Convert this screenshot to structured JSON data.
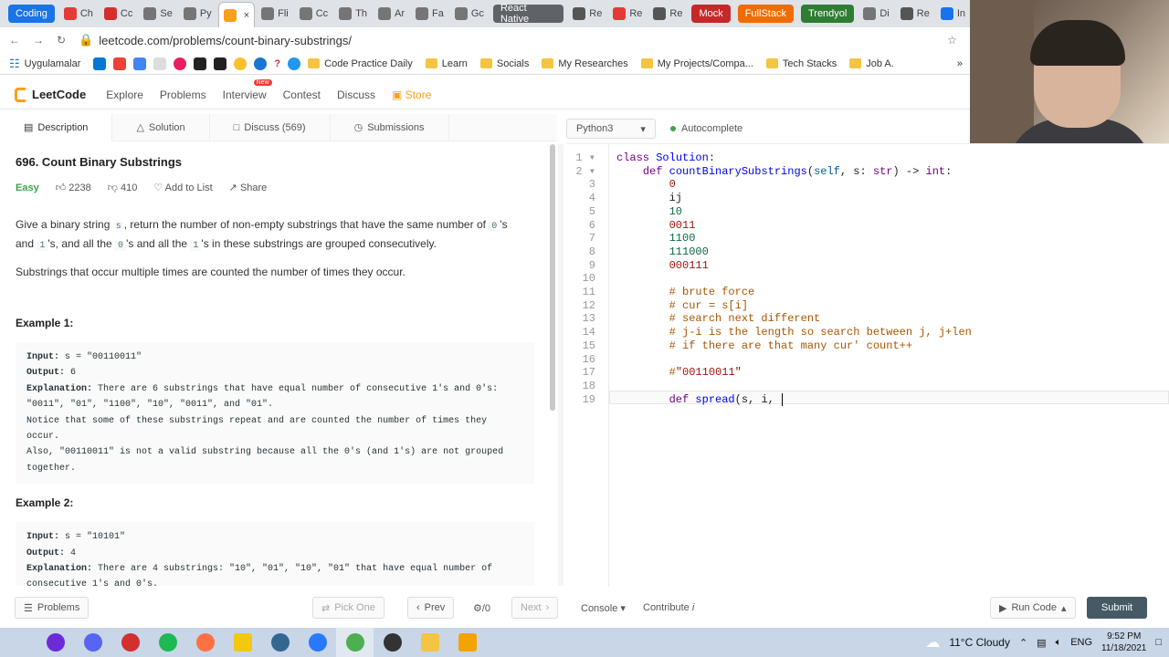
{
  "browser": {
    "tabs": [
      {
        "label": "Coding",
        "type": "group",
        "color": "#1a73e8"
      },
      {
        "label": "Ch",
        "color": "#e53935"
      },
      {
        "label": "Cc",
        "color": "#d32f2f"
      },
      {
        "label": "Se",
        "color": "#757575"
      },
      {
        "label": "Py",
        "color": "#757575"
      },
      {
        "label": "",
        "color": "#f89f1b",
        "active": true
      },
      {
        "label": "Fli",
        "color": "#757575"
      },
      {
        "label": "Cc",
        "color": "#757575"
      },
      {
        "label": "Th",
        "color": "#757575"
      },
      {
        "label": "Ar",
        "color": "#757575"
      },
      {
        "label": "Fa",
        "color": "#757575"
      },
      {
        "label": "Gc",
        "color": "#757575"
      },
      {
        "label": "React Native",
        "type": "group",
        "color": "#5f6368"
      },
      {
        "label": "Re",
        "color": "#555"
      },
      {
        "label": "Re",
        "color": "#e53935"
      },
      {
        "label": "Re",
        "color": "#555"
      },
      {
        "label": "Mock",
        "type": "group",
        "color": "#c62828"
      },
      {
        "label": "FullStack",
        "type": "group",
        "color": "#ef6c00"
      },
      {
        "label": "Trendyol",
        "type": "group",
        "color": "#2e7d32"
      },
      {
        "label": "Di",
        "color": "#757575"
      },
      {
        "label": "Re",
        "color": "#555"
      },
      {
        "label": "In",
        "color": "#1a73e8"
      }
    ],
    "url": "leetcode.com/problems/count-binary-substrings/",
    "bookmarks": [
      "Uygulamalar",
      "Code Practice Daily",
      "Learn",
      "Socials",
      "My Researches",
      "My Projects/Compa...",
      "Tech Stacks",
      "Job A."
    ],
    "bookmarks_more": "»"
  },
  "nav": {
    "brand": "LeetCode",
    "items": [
      "Explore",
      "Problems",
      "Interview",
      "Contest",
      "Discuss"
    ],
    "new_badge": "New",
    "store": "Store"
  },
  "subtabs": [
    "Description",
    "Solution",
    "Discuss (569)",
    "Submissions"
  ],
  "problem": {
    "title": "696. Count Binary Substrings",
    "difficulty": "Easy",
    "likes": "2238",
    "dislikes": "410",
    "add_to_list": "Add to List",
    "share": "Share",
    "desc_1a": "Give a binary string ",
    "desc_1_s": "s",
    "desc_1b": ", return the number of non-empty substrings that have the same number of ",
    "desc_zero": "0",
    "desc_1c": "'s and ",
    "desc_one": "1",
    "desc_1d": "'s, and all the ",
    "desc_1e": "'s and all the ",
    "desc_1f": "'s in these substrings are grouped consecutively.",
    "desc_2": "Substrings that occur multiple times are counted the number of times they occur.",
    "example1_title": "Example 1:",
    "ex1_input_label": "Input:",
    "ex1_input": " s = \"00110011\"",
    "ex1_output_label": "Output:",
    "ex1_output": " 6",
    "ex1_expl_label": "Explanation:",
    "ex1_expl": " There are 6 substrings that have equal number of consecutive 1's and 0's: \"0011\", \"01\", \"1100\", \"10\", \"0011\", and \"01\".\nNotice that some of these substrings repeat and are counted the number of times they occur.\nAlso, \"00110011\" is not a valid substring because all the 0's (and 1's) are not grouped together.",
    "example2_title": "Example 2:",
    "ex2_input_label": "Input:",
    "ex2_input": " s = \"10101\"",
    "ex2_output_label": "Output:",
    "ex2_output": " 4",
    "ex2_expl_label": "Explanation:",
    "ex2_expl": " There are 4 substrings: \"10\", \"01\", \"10\", \"01\" that have equal number of consecutive 1's and 0's."
  },
  "editor": {
    "language": "Python3",
    "autocomplete": "Autocomplete",
    "lines": [
      "class Solution:",
      "    def countBinarySubstrings(self, s: str) -> int:",
      "        0",
      "        ij",
      "        10",
      "        0011",
      "        1100",
      "        111000",
      "        000111",
      "",
      "        # brute force",
      "        # cur = s[i]",
      "        # search next different",
      "        # j-i is the length so search between j, j+len",
      "        # if there are that many cur' count++",
      "",
      "        #\"00110011\"",
      "",
      "        def spread(s, i, "
    ]
  },
  "bottom": {
    "problems": "Problems",
    "pick_one": "Pick One",
    "prev": "Prev",
    "page": "/0",
    "next": "Next",
    "console": "Console",
    "contribute": "Contribute",
    "run_code": "Run Code",
    "submit": "Submit"
  },
  "taskbar": {
    "weather": "11°C  Cloudy",
    "lang": "ENG",
    "time": "9:52 PM",
    "date": "11/18/2021",
    "apps": [
      "#6c2bd9",
      "#5865f2",
      "#d32f2f",
      "#1db954",
      "#ff7043",
      "#f2c811",
      "#336791",
      "#2979ff",
      "#4caf50",
      "#333",
      "#f4c542",
      "#f4a300"
    ]
  }
}
